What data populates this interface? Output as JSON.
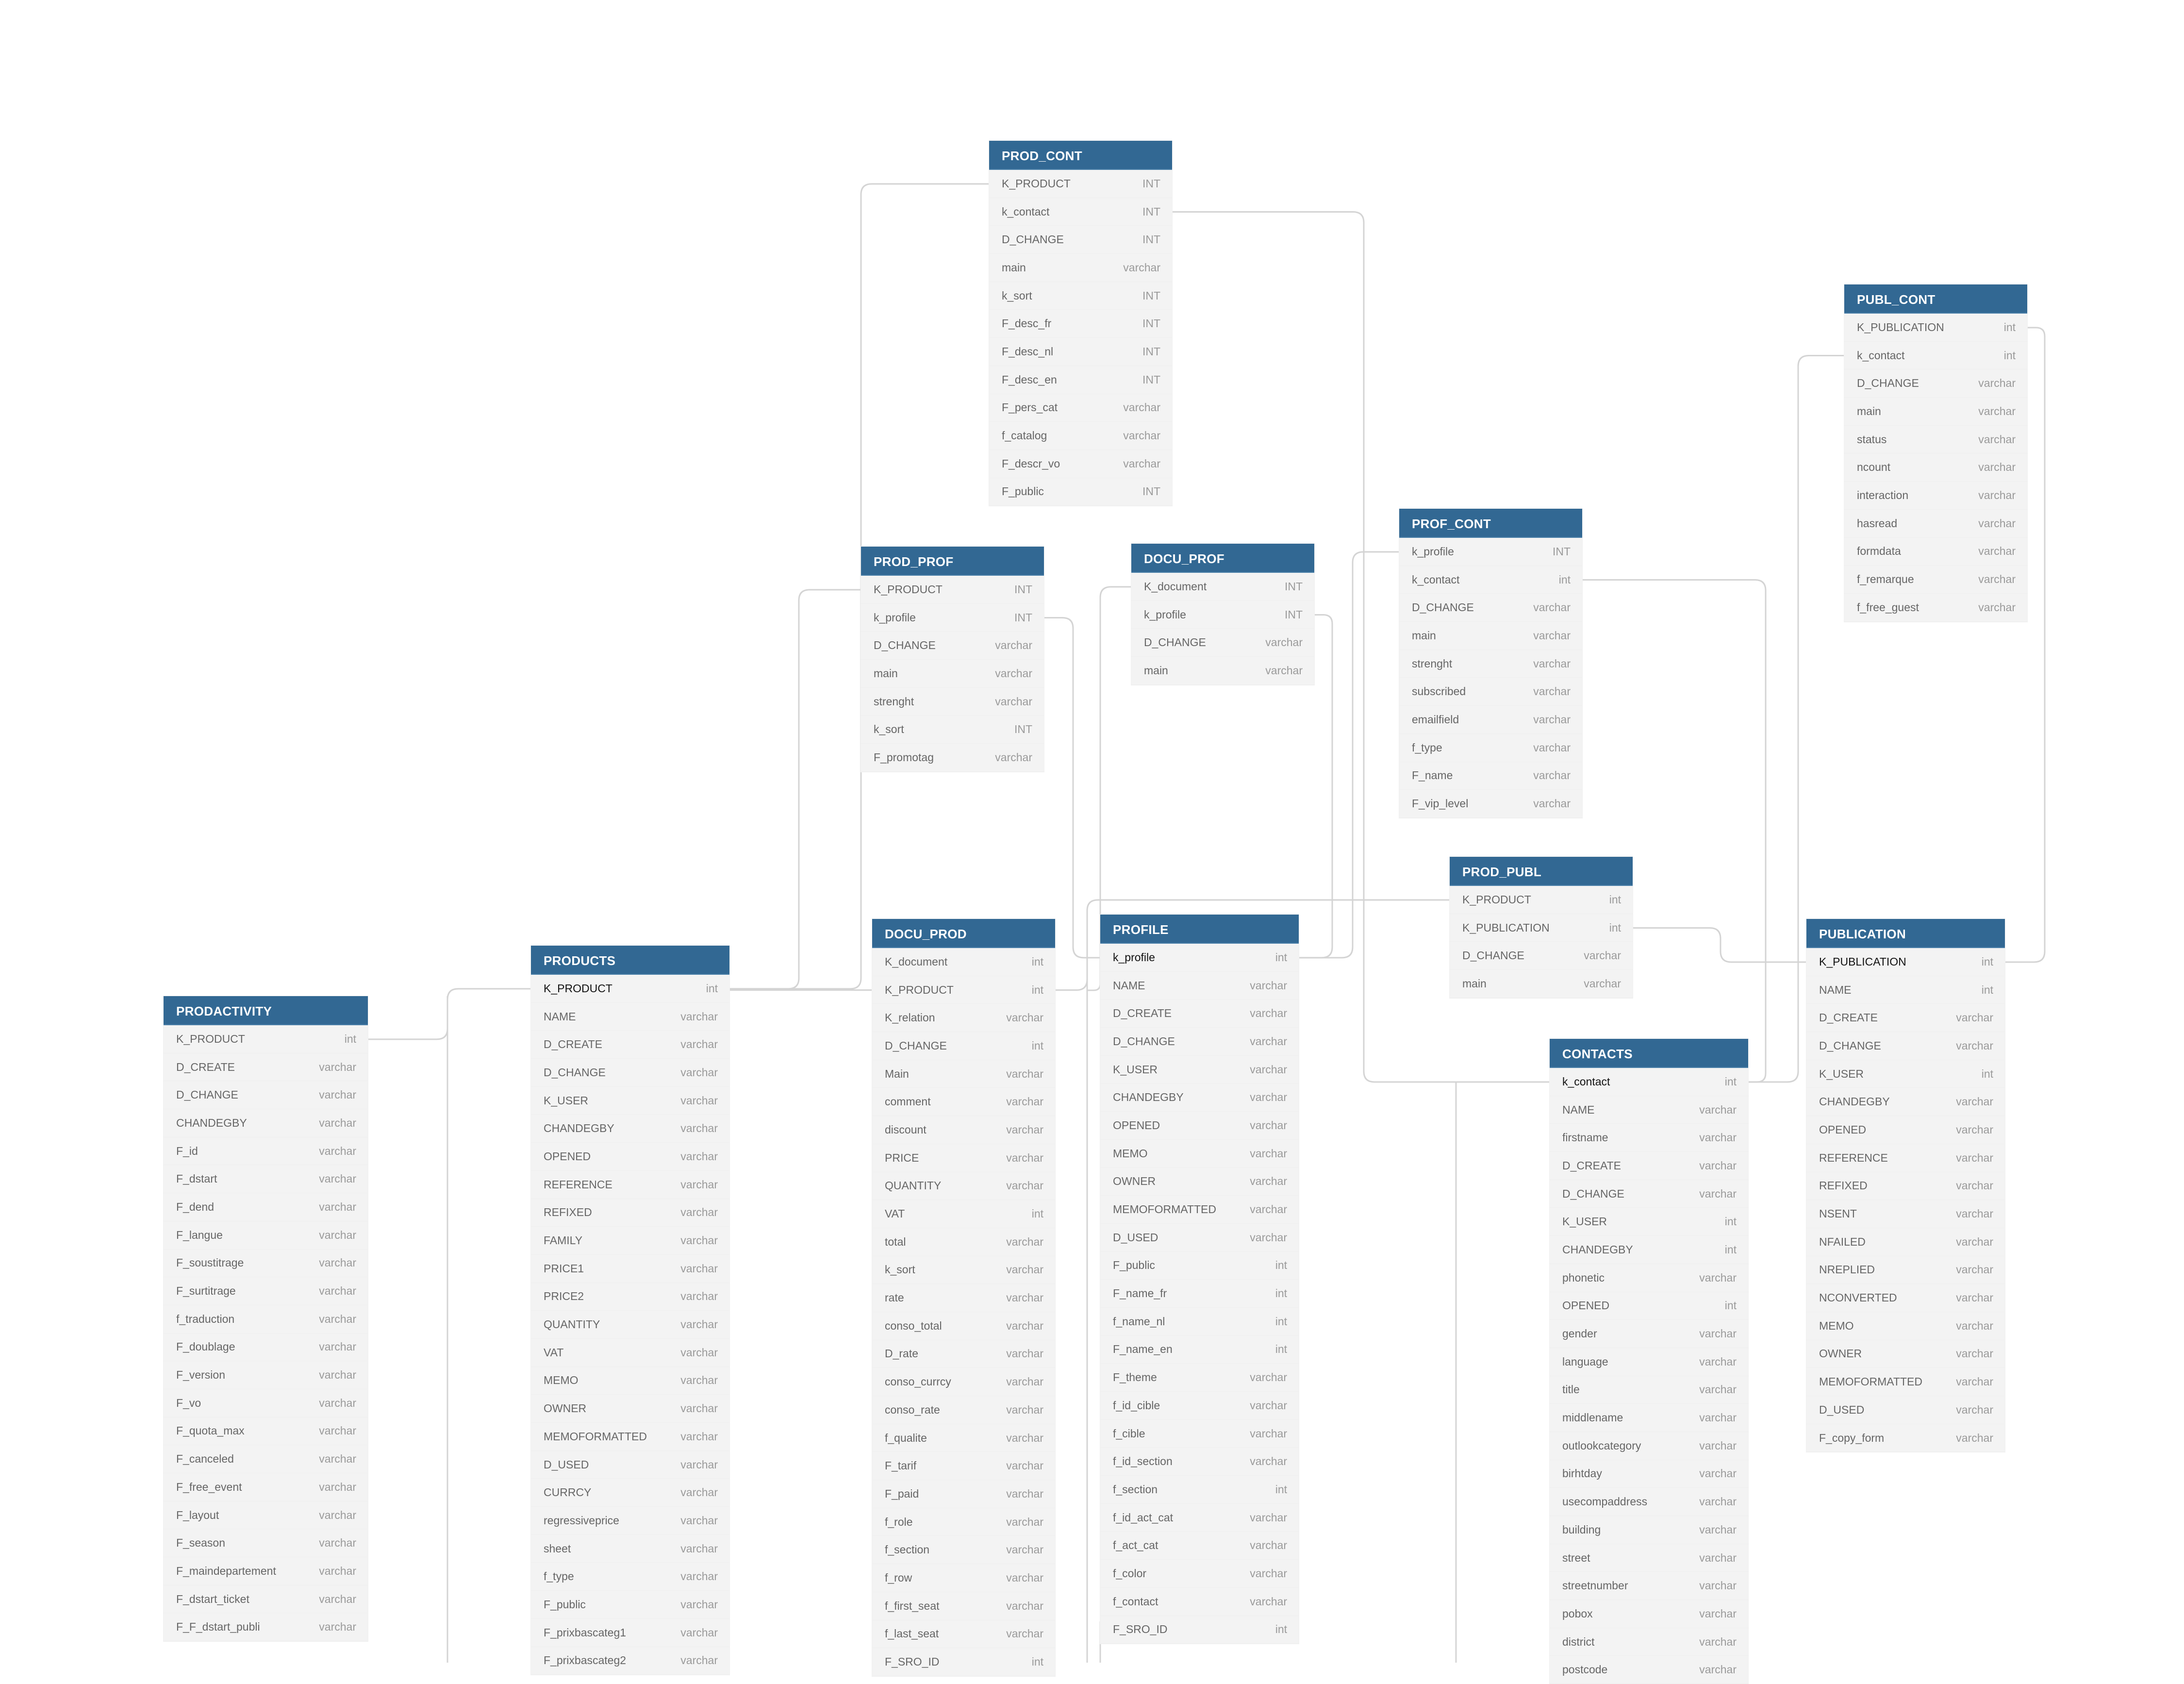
{
  "diagram": {
    "type": "entity-relationship",
    "header_color": "#326893",
    "body_color": "#f3f3f3",
    "link_color": "#d4d4d4"
  },
  "tables": [
    {
      "name": "PROD_CONT",
      "fields": [
        {
          "name": "K_PRODUCT",
          "type": "INT"
        },
        {
          "name": "k_contact",
          "type": "INT"
        },
        {
          "name": "D_CHANGE",
          "type": "INT"
        },
        {
          "name": "main",
          "type": "varchar"
        },
        {
          "name": "k_sort",
          "type": "INT"
        },
        {
          "name": "F_desc_fr",
          "type": "INT"
        },
        {
          "name": "F_desc_nl",
          "type": "INT"
        },
        {
          "name": "F_desc_en",
          "type": "INT"
        },
        {
          "name": "F_pers_cat",
          "type": "varchar"
        },
        {
          "name": "f_catalog",
          "type": "varchar"
        },
        {
          "name": "F_descr_vo",
          "type": "varchar"
        },
        {
          "name": "F_public",
          "type": "INT"
        }
      ]
    },
    {
      "name": "PROD_PROF",
      "fields": [
        {
          "name": "K_PRODUCT",
          "type": "INT"
        },
        {
          "name": "k_profile",
          "type": "INT"
        },
        {
          "name": "D_CHANGE",
          "type": "varchar"
        },
        {
          "name": "main",
          "type": "varchar"
        },
        {
          "name": "strenght",
          "type": "varchar"
        },
        {
          "name": "k_sort",
          "type": "INT"
        },
        {
          "name": "F_promotag",
          "type": "varchar"
        }
      ]
    },
    {
      "name": "DOCU_PROF",
      "fields": [
        {
          "name": "K_document",
          "type": "INT"
        },
        {
          "name": "k_profile",
          "type": "INT"
        },
        {
          "name": "D_CHANGE",
          "type": "varchar"
        },
        {
          "name": "main",
          "type": "varchar"
        }
      ]
    },
    {
      "name": "PROF_CONT",
      "fields": [
        {
          "name": "k_profile",
          "type": "INT"
        },
        {
          "name": "k_contact",
          "type": "int"
        },
        {
          "name": "D_CHANGE",
          "type": "varchar"
        },
        {
          "name": "main",
          "type": "varchar"
        },
        {
          "name": "strenght",
          "type": "varchar"
        },
        {
          "name": "subscribed",
          "type": "varchar"
        },
        {
          "name": "emailfield",
          "type": "varchar"
        },
        {
          "name": "f_type",
          "type": "varchar"
        },
        {
          "name": "F_name",
          "type": "varchar"
        },
        {
          "name": "F_vip_level",
          "type": "varchar"
        }
      ]
    },
    {
      "name": "PUBL_CONT",
      "fields": [
        {
          "name": "K_PUBLICATION",
          "type": "int"
        },
        {
          "name": "k_contact",
          "type": "int"
        },
        {
          "name": "D_CHANGE",
          "type": "varchar"
        },
        {
          "name": "main",
          "type": "varchar"
        },
        {
          "name": "status",
          "type": "varchar"
        },
        {
          "name": "ncount",
          "type": "varchar"
        },
        {
          "name": "interaction",
          "type": "varchar"
        },
        {
          "name": "hasread",
          "type": "varchar"
        },
        {
          "name": "formdata",
          "type": "varchar"
        },
        {
          "name": "f_remarque",
          "type": "varchar"
        },
        {
          "name": "f_free_guest",
          "type": "varchar"
        }
      ]
    },
    {
      "name": "PROD_PUBL",
      "fields": [
        {
          "name": "K_PRODUCT",
          "type": "int"
        },
        {
          "name": "K_PUBLICATION",
          "type": "int"
        },
        {
          "name": "D_CHANGE",
          "type": "varchar"
        },
        {
          "name": "main",
          "type": "varchar"
        }
      ]
    },
    {
      "name": "PRODACTIVITY",
      "fields": [
        {
          "name": "K_PRODUCT",
          "type": "int"
        },
        {
          "name": "D_CREATE",
          "type": "varchar"
        },
        {
          "name": "D_CHANGE",
          "type": "varchar"
        },
        {
          "name": "CHANDEGBY",
          "type": "varchar"
        },
        {
          "name": "F_id",
          "type": "varchar"
        },
        {
          "name": "F_dstart",
          "type": "varchar"
        },
        {
          "name": "F_dend",
          "type": "varchar"
        },
        {
          "name": "F_langue",
          "type": "varchar"
        },
        {
          "name": "F_soustitrage",
          "type": "varchar"
        },
        {
          "name": "F_surtitrage",
          "type": "varchar"
        },
        {
          "name": "f_traduction",
          "type": "varchar"
        },
        {
          "name": "F_doublage",
          "type": "varchar"
        },
        {
          "name": "F_version",
          "type": "varchar"
        },
        {
          "name": "F_vo",
          "type": "varchar"
        },
        {
          "name": "F_quota_max",
          "type": "varchar"
        },
        {
          "name": "F_canceled",
          "type": "varchar"
        },
        {
          "name": "F_free_event",
          "type": "varchar"
        },
        {
          "name": "F_layout",
          "type": "varchar"
        },
        {
          "name": "F_season",
          "type": "varchar"
        },
        {
          "name": "F_maindepartement",
          "type": "varchar"
        },
        {
          "name": "F_dstart_ticket",
          "type": "varchar"
        },
        {
          "name": "F_F_dstart_publi",
          "type": "varchar"
        }
      ]
    },
    {
      "name": "PRODUCTS",
      "fields": [
        {
          "name": "K_PRODUCT",
          "type": "int",
          "pk": true
        },
        {
          "name": "NAME",
          "type": "varchar"
        },
        {
          "name": "D_CREATE",
          "type": "varchar"
        },
        {
          "name": "D_CHANGE",
          "type": "varchar"
        },
        {
          "name": "K_USER",
          "type": "varchar"
        },
        {
          "name": "CHANDEGBY",
          "type": "varchar"
        },
        {
          "name": "OPENED",
          "type": "varchar"
        },
        {
          "name": "REFERENCE",
          "type": "varchar"
        },
        {
          "name": "REFIXED",
          "type": "varchar"
        },
        {
          "name": "FAMILY",
          "type": "varchar"
        },
        {
          "name": "PRICE1",
          "type": "varchar"
        },
        {
          "name": "PRICE2",
          "type": "varchar"
        },
        {
          "name": "QUANTITY",
          "type": "varchar"
        },
        {
          "name": "VAT",
          "type": "varchar"
        },
        {
          "name": "MEMO",
          "type": "varchar"
        },
        {
          "name": "OWNER",
          "type": "varchar"
        },
        {
          "name": "MEMOFORMATTED",
          "type": "varchar"
        },
        {
          "name": "D_USED",
          "type": "varchar"
        },
        {
          "name": "CURRCY",
          "type": "varchar"
        },
        {
          "name": "regressiveprice",
          "type": "varchar"
        },
        {
          "name": "sheet",
          "type": "varchar"
        },
        {
          "name": "f_type",
          "type": "varchar"
        },
        {
          "name": "F_public",
          "type": "varchar"
        },
        {
          "name": "F_prixbascateg1",
          "type": "varchar"
        },
        {
          "name": "F_prixbascateg2",
          "type": "varchar"
        }
      ]
    },
    {
      "name": "DOCU_PROD",
      "fields": [
        {
          "name": "K_document",
          "type": "int"
        },
        {
          "name": "K_PRODUCT",
          "type": "int"
        },
        {
          "name": "K_relation",
          "type": "varchar"
        },
        {
          "name": "D_CHANGE",
          "type": "int"
        },
        {
          "name": "Main",
          "type": "varchar"
        },
        {
          "name": "comment",
          "type": "varchar"
        },
        {
          "name": "discount",
          "type": "varchar"
        },
        {
          "name": "PRICE",
          "type": "varchar"
        },
        {
          "name": "QUANTITY",
          "type": "varchar"
        },
        {
          "name": "VAT",
          "type": "int"
        },
        {
          "name": "total",
          "type": "varchar"
        },
        {
          "name": "k_sort",
          "type": "varchar"
        },
        {
          "name": "rate",
          "type": "varchar"
        },
        {
          "name": "conso_total",
          "type": "varchar"
        },
        {
          "name": "D_rate",
          "type": "varchar"
        },
        {
          "name": "conso_currcy",
          "type": "varchar"
        },
        {
          "name": "conso_rate",
          "type": "varchar"
        },
        {
          "name": "f_qualite",
          "type": "varchar"
        },
        {
          "name": "F_tarif",
          "type": "varchar"
        },
        {
          "name": "F_paid",
          "type": "varchar"
        },
        {
          "name": "f_role",
          "type": "varchar"
        },
        {
          "name": "f_section",
          "type": "varchar"
        },
        {
          "name": "f_row",
          "type": "varchar"
        },
        {
          "name": "f_first_seat",
          "type": "varchar"
        },
        {
          "name": "f_last_seat",
          "type": "varchar"
        },
        {
          "name": "F_SRO_ID",
          "type": "int"
        }
      ]
    },
    {
      "name": "PROFILE",
      "fields": [
        {
          "name": "k_profile",
          "type": "int",
          "pk": true
        },
        {
          "name": "NAME",
          "type": "varchar"
        },
        {
          "name": "D_CREATE",
          "type": "varchar"
        },
        {
          "name": "D_CHANGE",
          "type": "varchar"
        },
        {
          "name": "K_USER",
          "type": "varchar"
        },
        {
          "name": "CHANDEGBY",
          "type": "varchar"
        },
        {
          "name": "OPENED",
          "type": "varchar"
        },
        {
          "name": "MEMO",
          "type": "varchar"
        },
        {
          "name": "OWNER",
          "type": "varchar"
        },
        {
          "name": "MEMOFORMATTED",
          "type": "varchar"
        },
        {
          "name": "D_USED",
          "type": "varchar"
        },
        {
          "name": "F_public",
          "type": "int"
        },
        {
          "name": "F_name_fr",
          "type": "int"
        },
        {
          "name": "f_name_nl",
          "type": "int"
        },
        {
          "name": "F_name_en",
          "type": "int"
        },
        {
          "name": "F_theme",
          "type": "varchar"
        },
        {
          "name": "f_id_cible",
          "type": "varchar"
        },
        {
          "name": "f_cible",
          "type": "varchar"
        },
        {
          "name": "f_id_section",
          "type": "varchar"
        },
        {
          "name": "f_section",
          "type": "int"
        },
        {
          "name": "f_id_act_cat",
          "type": "varchar"
        },
        {
          "name": "f_act_cat",
          "type": "varchar"
        },
        {
          "name": "f_color",
          "type": "varchar"
        },
        {
          "name": "f_contact",
          "type": "varchar"
        },
        {
          "name": "F_SRO_ID",
          "type": "int"
        }
      ]
    },
    {
      "name": "CONTACTS",
      "fields": [
        {
          "name": "k_contact",
          "type": "int",
          "pk": true
        },
        {
          "name": "NAME",
          "type": "varchar"
        },
        {
          "name": "firstname",
          "type": "varchar"
        },
        {
          "name": "D_CREATE",
          "type": "varchar"
        },
        {
          "name": "D_CHANGE",
          "type": "varchar"
        },
        {
          "name": "K_USER",
          "type": "int"
        },
        {
          "name": "CHANDEGBY",
          "type": "int"
        },
        {
          "name": "phonetic",
          "type": "varchar"
        },
        {
          "name": "OPENED",
          "type": "int"
        },
        {
          "name": "gender",
          "type": "varchar"
        },
        {
          "name": "language",
          "type": "varchar"
        },
        {
          "name": "title",
          "type": "varchar"
        },
        {
          "name": "middlename",
          "type": "varchar"
        },
        {
          "name": "outlookcategory",
          "type": "varchar"
        },
        {
          "name": "birhtday",
          "type": "varchar"
        },
        {
          "name": "usecompaddress",
          "type": "varchar"
        },
        {
          "name": "building",
          "type": "varchar"
        },
        {
          "name": "street",
          "type": "varchar"
        },
        {
          "name": "streetnumber",
          "type": "varchar"
        },
        {
          "name": "pobox",
          "type": "varchar"
        },
        {
          "name": "district",
          "type": "varchar"
        },
        {
          "name": "postcode",
          "type": "varchar"
        }
      ]
    },
    {
      "name": "PUBLICATION",
      "fields": [
        {
          "name": "K_PUBLICATION",
          "type": "int",
          "pk": true
        },
        {
          "name": "NAME",
          "type": "int"
        },
        {
          "name": "D_CREATE",
          "type": "varchar"
        },
        {
          "name": "D_CHANGE",
          "type": "varchar"
        },
        {
          "name": "K_USER",
          "type": "int"
        },
        {
          "name": "CHANDEGBY",
          "type": "varchar"
        },
        {
          "name": "OPENED",
          "type": "varchar"
        },
        {
          "name": "REFERENCE",
          "type": "varchar"
        },
        {
          "name": "REFIXED",
          "type": "varchar"
        },
        {
          "name": "NSENT",
          "type": "varchar"
        },
        {
          "name": "NFAILED",
          "type": "varchar"
        },
        {
          "name": "NREPLIED",
          "type": "varchar"
        },
        {
          "name": "NCONVERTED",
          "type": "varchar"
        },
        {
          "name": "MEMO",
          "type": "varchar"
        },
        {
          "name": "OWNER",
          "type": "varchar"
        },
        {
          "name": "MEMOFORMATTED",
          "type": "varchar"
        },
        {
          "name": "D_USED",
          "type": "varchar"
        },
        {
          "name": "F_copy_form",
          "type": "varchar"
        }
      ]
    }
  ],
  "relationships": [
    {
      "from": "PRODACTIVITY.K_PRODUCT",
      "to": "PRODUCTS.K_PRODUCT"
    },
    {
      "from": "PROD_CONT.K_PRODUCT",
      "to": "PRODUCTS.K_PRODUCT"
    },
    {
      "from": "PROD_PROF.K_PRODUCT",
      "to": "PRODUCTS.K_PRODUCT"
    },
    {
      "from": "DOCU_PROD.K_PRODUCT",
      "to": "PRODUCTS.K_PRODUCT"
    },
    {
      "from": "PROD_PUBL.K_PRODUCT",
      "to": "PRODUCTS.K_PRODUCT"
    },
    {
      "from": "PROD_PROF.k_profile",
      "to": "PROFILE.k_profile"
    },
    {
      "from": "DOCU_PROF.k_profile",
      "to": "PROFILE.k_profile"
    },
    {
      "from": "PROF_CONT.k_profile",
      "to": "PROFILE.k_profile"
    },
    {
      "from": "PROD_CONT.k_contact",
      "to": "CONTACTS.k_contact"
    },
    {
      "from": "PROF_CONT.k_contact",
      "to": "CONTACTS.k_contact"
    },
    {
      "from": "PUBL_CONT.k_contact",
      "to": "CONTACTS.k_contact"
    },
    {
      "from": "PUBL_CONT.K_PUBLICATION",
      "to": "PUBLICATION.K_PUBLICATION"
    },
    {
      "from": "PROD_PUBL.K_PUBLICATION",
      "to": "PUBLICATION.K_PUBLICATION"
    },
    {
      "from": "DOCU_PROF.K_document",
      "to": "DOCU_PROD.K_document"
    }
  ]
}
